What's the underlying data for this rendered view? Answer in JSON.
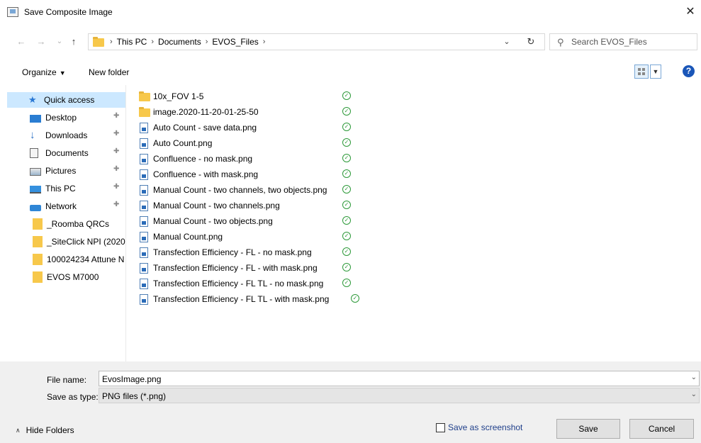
{
  "window": {
    "title": "Save Composite Image",
    "close_glyph": "✕"
  },
  "nav": {
    "back": "←",
    "forward": "→",
    "recent": "⌄",
    "up": "↑"
  },
  "address": {
    "crumbs": [
      "This PC",
      "Documents",
      "EVOS_Files"
    ],
    "sep": "›",
    "dropdown": "⌄",
    "refresh": "↻"
  },
  "search": {
    "placeholder": "Search EVOS_Files",
    "icon": "⚲"
  },
  "toolbar": {
    "organize": "Organize",
    "organize_caret": "▼",
    "new_folder": "New folder",
    "view_caret": "▼",
    "help": "?"
  },
  "sidebar": {
    "items": [
      {
        "label": "Quick access",
        "icon": "star-icon",
        "pinned": false
      },
      {
        "label": "Desktop",
        "icon": "desktop-icon",
        "pinned": true
      },
      {
        "label": "Downloads",
        "icon": "download-icon",
        "pinned": true
      },
      {
        "label": "Documents",
        "icon": "documents-icon",
        "pinned": true
      },
      {
        "label": "Pictures",
        "icon": "pictures-icon",
        "pinned": true
      },
      {
        "label": "This PC",
        "icon": "computer-icon",
        "pinned": true
      },
      {
        "label": "Network",
        "icon": "network-icon",
        "pinned": true
      },
      {
        "label": "_Roomba QRCs",
        "icon": "folder-icon",
        "pinned": false
      },
      {
        "label": "_SiteClick NPI (2020",
        "icon": "folder-icon",
        "pinned": false
      },
      {
        "label": "100024234 Attune N",
        "icon": "folder-icon",
        "pinned": false
      },
      {
        "label": "EVOS M7000",
        "icon": "folder-icon",
        "pinned": false
      }
    ],
    "pin_glyph": "📌"
  },
  "files": [
    {
      "name": "10x_FOV 1-5",
      "type": "folder"
    },
    {
      "name": "image.2020-11-20-01-25-50",
      "type": "folder"
    },
    {
      "name": "Auto Count - save data.png",
      "type": "png"
    },
    {
      "name": "Auto Count.png",
      "type": "png"
    },
    {
      "name": "Confluence -  no mask.png",
      "type": "png"
    },
    {
      "name": "Confluence -  with mask.png",
      "type": "png"
    },
    {
      "name": "Manual Count - two channels, two objects.png",
      "type": "png"
    },
    {
      "name": "Manual Count - two channels.png",
      "type": "png"
    },
    {
      "name": "Manual Count - two objects.png",
      "type": "png"
    },
    {
      "name": "Manual Count.png",
      "type": "png"
    },
    {
      "name": "Transfection Efficiency - FL - no mask.png",
      "type": "png"
    },
    {
      "name": "Transfection Efficiency - FL - with mask.png",
      "type": "png"
    },
    {
      "name": "Transfection Efficiency - FL TL - no mask.png",
      "type": "png"
    },
    {
      "name": "Transfection Efficiency - FL TL - with mask.png",
      "type": "png"
    }
  ],
  "sync_status_glyph": "✓",
  "footer": {
    "file_name_label": "File name:",
    "file_name_value": "EvosImage.png",
    "save_type_label": "Save as type:",
    "save_type_value": "PNG files (*.png)",
    "dropdown": "⌄",
    "hide_folders": "Hide Folders",
    "hide_caret": "∧",
    "save_as_screenshot": "Save as screenshot",
    "save": "Save",
    "cancel": "Cancel"
  },
  "colors": {
    "selected_bg": "#cce8ff",
    "folder": "#f7c84b",
    "sync_green": "#2e9a3a",
    "help_blue": "#1a56b8"
  }
}
